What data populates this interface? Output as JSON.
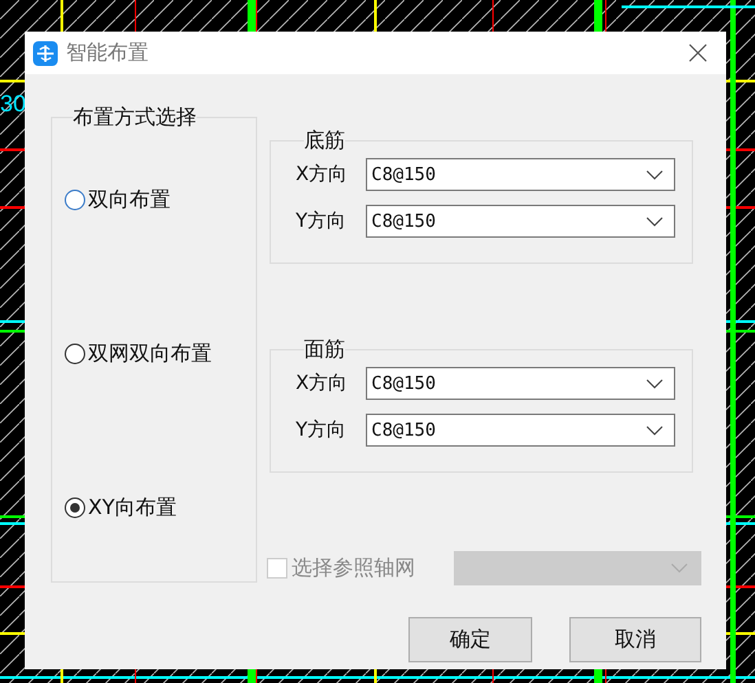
{
  "background": {
    "texts": [
      "30"
    ]
  },
  "window": {
    "title": "智能布置"
  },
  "mode_group": {
    "title": "布置方式选择",
    "options": [
      {
        "label": "双向布置",
        "selected": false
      },
      {
        "label": "双网双向布置",
        "selected": false
      },
      {
        "label": "XY向布置",
        "selected": true
      }
    ]
  },
  "groups": [
    {
      "title": "底筋",
      "rows": [
        {
          "label": "X方向",
          "value": "C8@150"
        },
        {
          "label": "Y方向",
          "value": "C8@150"
        }
      ]
    },
    {
      "title": "面筋",
      "rows": [
        {
          "label": "X方向",
          "value": "C8@150"
        },
        {
          "label": "Y方向",
          "value": "C8@150"
        }
      ]
    }
  ],
  "reference_axis": {
    "label": "选择参照轴网",
    "checked": false,
    "disabled": true
  },
  "buttons": [
    "确定",
    "取消"
  ]
}
